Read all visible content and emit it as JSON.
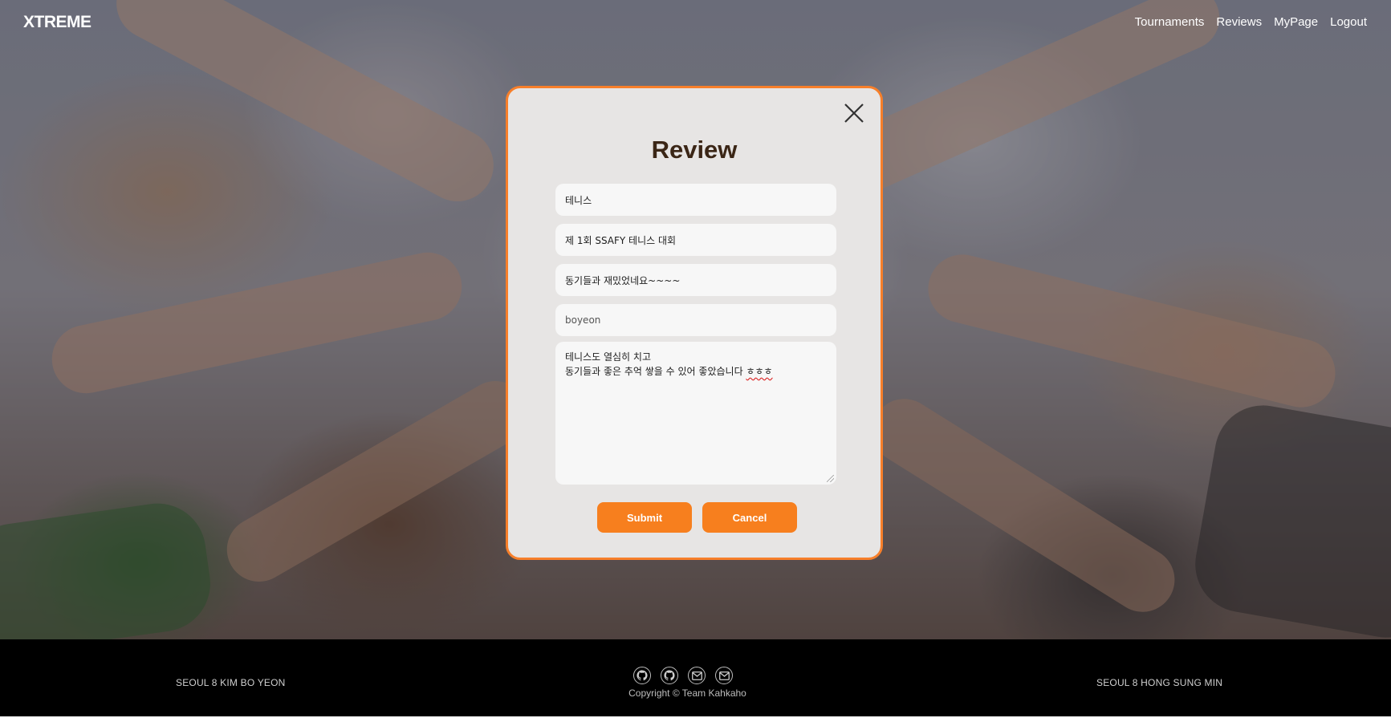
{
  "nav": {
    "logo": "XTREME",
    "links": [
      "Tournaments",
      "Reviews",
      "MyPage",
      "Logout"
    ]
  },
  "modal": {
    "title": "Review",
    "fields": {
      "sport": "테니스",
      "tournament": "제 1회 SSAFY 테니스 대회",
      "review_title": "동기들과 재밌었네요~~~~",
      "author": "boyeon"
    },
    "content_line1": "테니스도 열심히 치고",
    "content_line2_text": "동기들과 좋은 추억 쌓을 수 있어 좋았습니다 ",
    "content_line2_marked": "ㅎㅎㅎ",
    "submit_label": "Submit",
    "cancel_label": "Cancel"
  },
  "footer": {
    "left_text": "SEOUL 8 KIM BO YEON",
    "right_text": "SEOUL 8 HONG SUNG MIN",
    "icons": [
      "github-icon",
      "github-icon",
      "mail-icon",
      "mail-icon"
    ],
    "copyright": "Copyright © Team Kahkaho"
  },
  "colors": {
    "accent": "#f77f1e",
    "modal_border": "#f77f2a",
    "title": "#3b2616",
    "footer_bg": "#000000"
  }
}
